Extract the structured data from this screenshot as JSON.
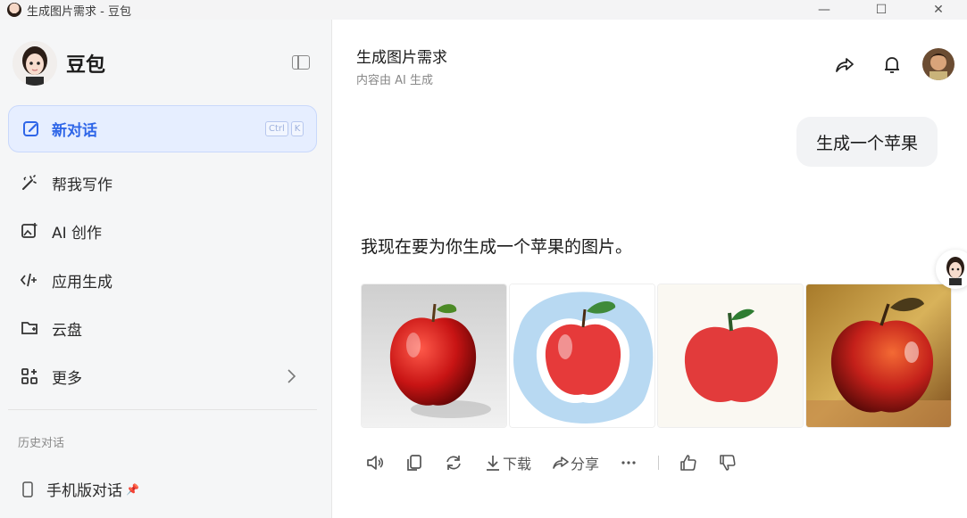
{
  "window": {
    "title": "生成图片需求 - 豆包"
  },
  "sidebar": {
    "brand": "豆包",
    "new_chat": {
      "label": "新对话",
      "shortcut": [
        "Ctrl",
        "K"
      ]
    },
    "items": [
      {
        "label": "帮我写作",
        "icon": "writing-icon"
      },
      {
        "label": "AI 创作",
        "icon": "image-create-icon"
      },
      {
        "label": "应用生成",
        "icon": "code-icon"
      },
      {
        "label": "云盘",
        "icon": "cloud-drive-icon"
      },
      {
        "label": "更多",
        "icon": "grid-icon"
      }
    ],
    "history_title": "历史对话",
    "history": [
      {
        "label": "手机版对话",
        "pinned": true
      }
    ]
  },
  "main": {
    "title": "生成图片需求",
    "subtitle": "内容由 AI 生成",
    "user_message": "生成一个苹果",
    "assistant_text": "我现在要为你生成一个苹果的图片。",
    "actions": {
      "download": "下载",
      "share": "分享"
    }
  },
  "colors": {
    "accent": "#2f66e8",
    "new_chat_bg": "#e6eeff",
    "apple_red": "#d42b2b"
  }
}
